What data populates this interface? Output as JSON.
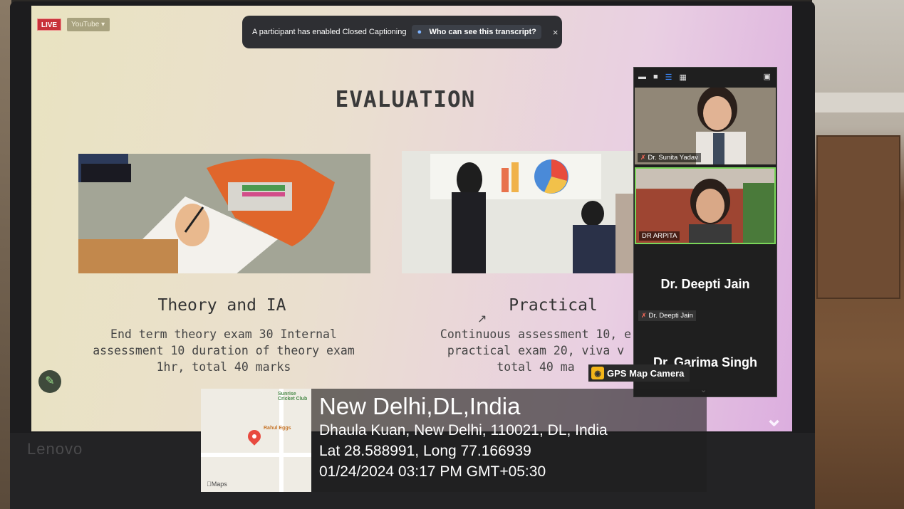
{
  "screen": {
    "live_badge": "LIVE",
    "youtube_badge": "YouTube",
    "youtube_caret": "▾",
    "cc_toast": {
      "text": "A participant has enabled Closed Captioning",
      "link_label": "Who can see this transcript?",
      "close": "×"
    }
  },
  "slide": {
    "title": "EVALUATION",
    "theory": {
      "title": "Theory and IA",
      "body": "End term theory exam 30 Internal\nassessment 10 duration of theory exam\n1hr, total 40 marks"
    },
    "practical": {
      "title": "Practical",
      "body": "Continuous assessment 10, e\npractical exam 20, viva v\ntotal 40 ma"
    }
  },
  "gallery": {
    "participants": [
      {
        "name": "Dr. Sunita Yadav",
        "muted": true
      },
      {
        "name": "DR ARPITA",
        "muted": false
      }
    ],
    "big_names": [
      "Dr. Deepti Jain",
      "Dr. Garima Singh"
    ],
    "deepti_tag": "Dr. Deepti Jain",
    "scroll_down": "⌄"
  },
  "gps": {
    "camera_label": "GPS Map Camera",
    "city": "New Delhi,DL,India",
    "address": "Dhaula Kuan, New Delhi, 110021, DL, India",
    "coords": "Lat 28.588991, Long 77.166939",
    "datetime": "01/24/2024 03:17 PM GMT+05:30",
    "map_labels": [
      "Sunrise Cricket Club",
      "Rahul Eggs"
    ],
    "maps_logo": "Maps"
  },
  "device": {
    "brand": "Lenovo"
  },
  "colors": {
    "live": "#c8323a",
    "active_speaker": "#7bd65a",
    "link_icon": "#3d8bff"
  }
}
